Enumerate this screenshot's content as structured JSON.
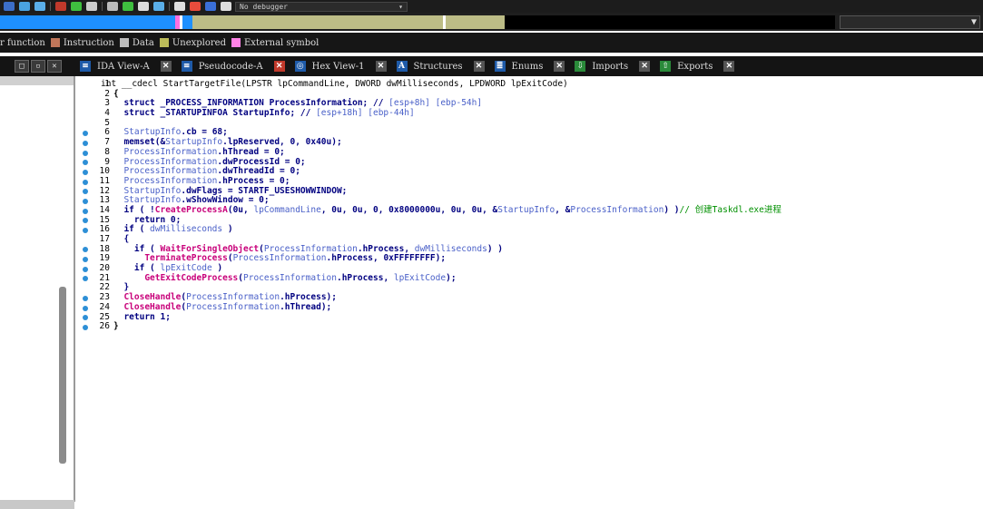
{
  "toolbar": {
    "debugger_label": "No debugger",
    "icon_colors": [
      "#3c6ec8",
      "#4aa3e0",
      "#5aaee8",
      "#c0392b",
      "#3fbf3f",
      "#cccccc",
      "#bbbbbb",
      "#3fbf3f",
      "#dddddd",
      "#5aaee8",
      "#e0e0e0",
      "#e74c3c",
      "#3a6fd8",
      "#dddddd"
    ]
  },
  "nav_band": {
    "segments": [
      {
        "color": "#1e90ff",
        "fraction": 0.21
      },
      {
        "color": "#ff70e0",
        "fraction": 0.005
      },
      {
        "color": "#ffffff",
        "fraction": 0.003
      },
      {
        "color": "#1e90ff",
        "fraction": 0.012
      },
      {
        "color": "#bcbc86",
        "fraction": 0.3
      },
      {
        "color": "#ffffff",
        "fraction": 0.004
      },
      {
        "color": "#bcbc86",
        "fraction": 0.07
      },
      {
        "color": "#000000",
        "fraction": 0.396
      }
    ],
    "select_arrow": "▼"
  },
  "legend": {
    "items": [
      {
        "label": "r function",
        "color": ""
      },
      {
        "label": "Instruction",
        "color": "#c0765a"
      },
      {
        "label": "Data",
        "color": "#bdbdbd"
      },
      {
        "label": "Unexplored",
        "color": "#bcbc5a"
      },
      {
        "label": "External symbol",
        "color": "#ff82e6"
      }
    ]
  },
  "window_controls": [
    "□",
    "▫",
    "✕"
  ],
  "tabs": [
    {
      "label": "IDA View-A",
      "icon": "ida-view-icon",
      "icon_color": "#1e5aa8",
      "icon_glyph": "≡",
      "close": "✕",
      "active": false
    },
    {
      "label": "Pseudocode-A",
      "icon": "pseudocode-icon",
      "icon_color": "#1e5aa8",
      "icon_glyph": "≡",
      "close": "✕",
      "active": true
    },
    {
      "label": "Hex View-1",
      "icon": "hex-view-icon",
      "icon_color": "#1e5aa8",
      "icon_glyph": "◎",
      "close": "✕",
      "active": false
    },
    {
      "label": "Structures",
      "icon": "structures-icon",
      "icon_color": "#1e5aa8",
      "icon_glyph": "A",
      "close": "✕",
      "active": false
    },
    {
      "label": "Enums",
      "icon": "enums-icon",
      "icon_color": "#1e5aa8",
      "icon_glyph": "≣",
      "close": "✕",
      "active": false
    },
    {
      "label": "Imports",
      "icon": "imports-icon",
      "icon_color": "#2a8a3a",
      "icon_glyph": "⇩",
      "close": "✕",
      "active": false
    },
    {
      "label": "Exports",
      "icon": "exports-icon",
      "icon_color": "#2a8a3a",
      "icon_glyph": "⇧",
      "close": "✕",
      "active": false
    }
  ],
  "pseudocode": {
    "lines": [
      {
        "num": "1",
        "dot": false,
        "parts": [
          [
            "int __cdecl StartTargetFile(LPSTR lpCommandLine, DWORD dwMilliseconds, LPDWORD lpExitCode)",
            "p"
          ]
        ]
      },
      {
        "num": "2",
        "dot": false,
        "parts": [
          [
            "{",
            "n"
          ]
        ]
      },
      {
        "num": "3",
        "dot": false,
        "parts": [
          [
            "  struct _PROCESS_INFORMATION ProcessInformation; // ",
            "k"
          ],
          [
            "[esp+8h] [ebp-54h]",
            "v"
          ]
        ]
      },
      {
        "num": "4",
        "dot": false,
        "parts": [
          [
            "  struct _STARTUPINFOA StartupInfo; // ",
            "k"
          ],
          [
            "[esp+18h] [ebp-44h]",
            "v"
          ]
        ]
      },
      {
        "num": "5",
        "dot": false,
        "parts": []
      },
      {
        "num": "6",
        "dot": true,
        "parts": [
          [
            "  ",
            "p"
          ],
          [
            "StartupInfo",
            "v"
          ],
          [
            ".cb = 68;",
            "k"
          ]
        ]
      },
      {
        "num": "7",
        "dot": true,
        "parts": [
          [
            "  memset(&",
            "k"
          ],
          [
            "StartupInfo",
            "v"
          ],
          [
            ".lpReserved, 0, 0x40u);",
            "k"
          ]
        ]
      },
      {
        "num": "8",
        "dot": true,
        "parts": [
          [
            "  ",
            "p"
          ],
          [
            "ProcessInformation",
            "v"
          ],
          [
            ".hThread = 0;",
            "k"
          ]
        ]
      },
      {
        "num": "9",
        "dot": true,
        "parts": [
          [
            "  ",
            "p"
          ],
          [
            "ProcessInformation",
            "v"
          ],
          [
            ".dwProcessId = 0;",
            "k"
          ]
        ]
      },
      {
        "num": "10",
        "dot": true,
        "parts": [
          [
            "  ",
            "p"
          ],
          [
            "ProcessInformation",
            "v"
          ],
          [
            ".dwThreadId = 0;",
            "k"
          ]
        ]
      },
      {
        "num": "11",
        "dot": true,
        "parts": [
          [
            "  ",
            "p"
          ],
          [
            "ProcessInformation",
            "v"
          ],
          [
            ".hProcess = 0;",
            "k"
          ]
        ]
      },
      {
        "num": "12",
        "dot": true,
        "parts": [
          [
            "  ",
            "p"
          ],
          [
            "StartupInfo",
            "v"
          ],
          [
            ".dwFlags = STARTF_USESHOWWINDOW;",
            "k"
          ]
        ]
      },
      {
        "num": "13",
        "dot": true,
        "parts": [
          [
            "  ",
            "p"
          ],
          [
            "StartupInfo",
            "v"
          ],
          [
            ".wShowWindow = 0;",
            "k"
          ]
        ]
      },
      {
        "num": "14",
        "dot": true,
        "parts": [
          [
            "  if ( !",
            "k"
          ],
          [
            "CreateProcessA",
            "f"
          ],
          [
            "(0u, ",
            "k"
          ],
          [
            "lpCommandLine",
            "v"
          ],
          [
            ", 0u, 0u, 0, 0x8000000u, 0u, 0u, &",
            "k"
          ],
          [
            "StartupInfo",
            "v"
          ],
          [
            ", &",
            "k"
          ],
          [
            "ProcessInformation",
            "v"
          ],
          [
            ") )",
            "k"
          ],
          [
            "// 创建Taskdl.exe进程",
            "c"
          ]
        ]
      },
      {
        "num": "15",
        "dot": true,
        "parts": [
          [
            "    return 0;",
            "k"
          ]
        ]
      },
      {
        "num": "16",
        "dot": true,
        "parts": [
          [
            "  if ( ",
            "k"
          ],
          [
            "dwMilliseconds",
            "v"
          ],
          [
            " )",
            "k"
          ]
        ]
      },
      {
        "num": "17",
        "dot": false,
        "parts": [
          [
            "  {",
            "k"
          ]
        ]
      },
      {
        "num": "18",
        "dot": true,
        "parts": [
          [
            "    if ( ",
            "k"
          ],
          [
            "WaitForSingleObject",
            "f"
          ],
          [
            "(",
            "k"
          ],
          [
            "ProcessInformation",
            "v"
          ],
          [
            ".hProcess, ",
            "k"
          ],
          [
            "dwMilliseconds",
            "v"
          ],
          [
            ") )",
            "k"
          ]
        ]
      },
      {
        "num": "19",
        "dot": true,
        "parts": [
          [
            "      ",
            "p"
          ],
          [
            "TerminateProcess",
            "f"
          ],
          [
            "(",
            "k"
          ],
          [
            "ProcessInformation",
            "v"
          ],
          [
            ".hProcess, 0xFFFFFFFF);",
            "k"
          ]
        ]
      },
      {
        "num": "20",
        "dot": true,
        "parts": [
          [
            "    if ( ",
            "k"
          ],
          [
            "lpExitCode",
            "v"
          ],
          [
            " )",
            "k"
          ]
        ]
      },
      {
        "num": "21",
        "dot": true,
        "parts": [
          [
            "      ",
            "p"
          ],
          [
            "GetExitCodeProcess",
            "f"
          ],
          [
            "(",
            "k"
          ],
          [
            "ProcessInformation",
            "v"
          ],
          [
            ".hProcess, ",
            "k"
          ],
          [
            "lpExitCode",
            "v"
          ],
          [
            ");",
            "k"
          ]
        ]
      },
      {
        "num": "22",
        "dot": false,
        "parts": [
          [
            "  }",
            "k"
          ]
        ]
      },
      {
        "num": "23",
        "dot": true,
        "parts": [
          [
            "  ",
            "p"
          ],
          [
            "CloseHandle",
            "f"
          ],
          [
            "(",
            "k"
          ],
          [
            "ProcessInformation",
            "v"
          ],
          [
            ".hProcess);",
            "k"
          ]
        ]
      },
      {
        "num": "24",
        "dot": true,
        "parts": [
          [
            "  ",
            "p"
          ],
          [
            "CloseHandle",
            "f"
          ],
          [
            "(",
            "k"
          ],
          [
            "ProcessInformation",
            "v"
          ],
          [
            ".hThread);",
            "k"
          ]
        ]
      },
      {
        "num": "25",
        "dot": true,
        "parts": [
          [
            "  return 1;",
            "k"
          ]
        ]
      },
      {
        "num": "26",
        "dot": true,
        "parts": [
          [
            "}",
            "n"
          ]
        ]
      }
    ]
  }
}
